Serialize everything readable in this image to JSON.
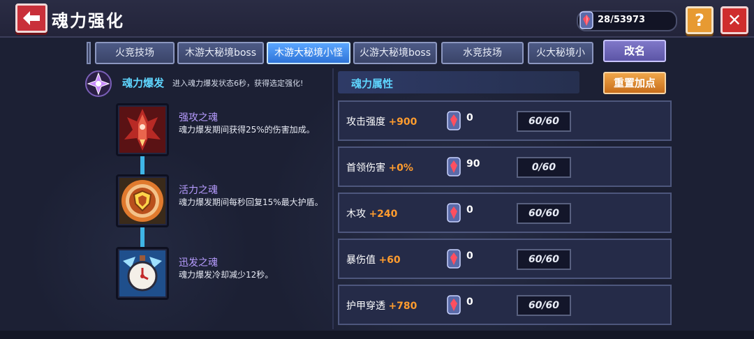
{
  "header": {
    "title": "魂力强化",
    "currency": "28/53973",
    "help_label": "?",
    "close_label": "✕"
  },
  "tabs": [
    {
      "label": "火竞技场"
    },
    {
      "label": "木游大秘境boss"
    },
    {
      "label": "木游大秘境小怪",
      "active": true
    },
    {
      "label": "火游大秘境boss"
    },
    {
      "label": "水竞技场"
    },
    {
      "label": "火大秘境小"
    }
  ],
  "rename_label": "改名",
  "burst": {
    "title": "魂力爆发",
    "desc": "进入魂力爆发状态6秒，获得选定强化!"
  },
  "souls": [
    {
      "name": "强攻之魂",
      "desc": "魂力爆发期间获得25%的伤害加成。",
      "icon": "red-rocket-icon"
    },
    {
      "name": "活力之魂",
      "desc": "魂力爆发期间每秒回复15%最大护盾。",
      "icon": "gold-shield-icon"
    },
    {
      "name": "迅发之魂",
      "desc": "魂力爆发冷却减少12秒。",
      "icon": "stopwatch-icon"
    }
  ],
  "attributes": {
    "title": "魂力属性",
    "reset_label": "重置加点",
    "rows": [
      {
        "label": "攻击强度",
        "bonus": "+900",
        "cost": "0",
        "level": "60/60"
      },
      {
        "label": "首领伤害",
        "bonus": "+0%",
        "cost": "90",
        "level": "0/60"
      },
      {
        "label": "木攻",
        "bonus": "+240",
        "cost": "0",
        "level": "60/60"
      },
      {
        "label": "暴伤值",
        "bonus": "+60",
        "cost": "0",
        "level": "60/60"
      },
      {
        "label": "护甲穿透",
        "bonus": "+780",
        "cost": "0",
        "level": "60/60"
      }
    ]
  },
  "colors": {
    "accent_cyan": "#5fd6ff",
    "bonus_orange": "#ff9c2e",
    "soul_name_purple": "#b79cff",
    "active_tab": "#2f74d8"
  }
}
